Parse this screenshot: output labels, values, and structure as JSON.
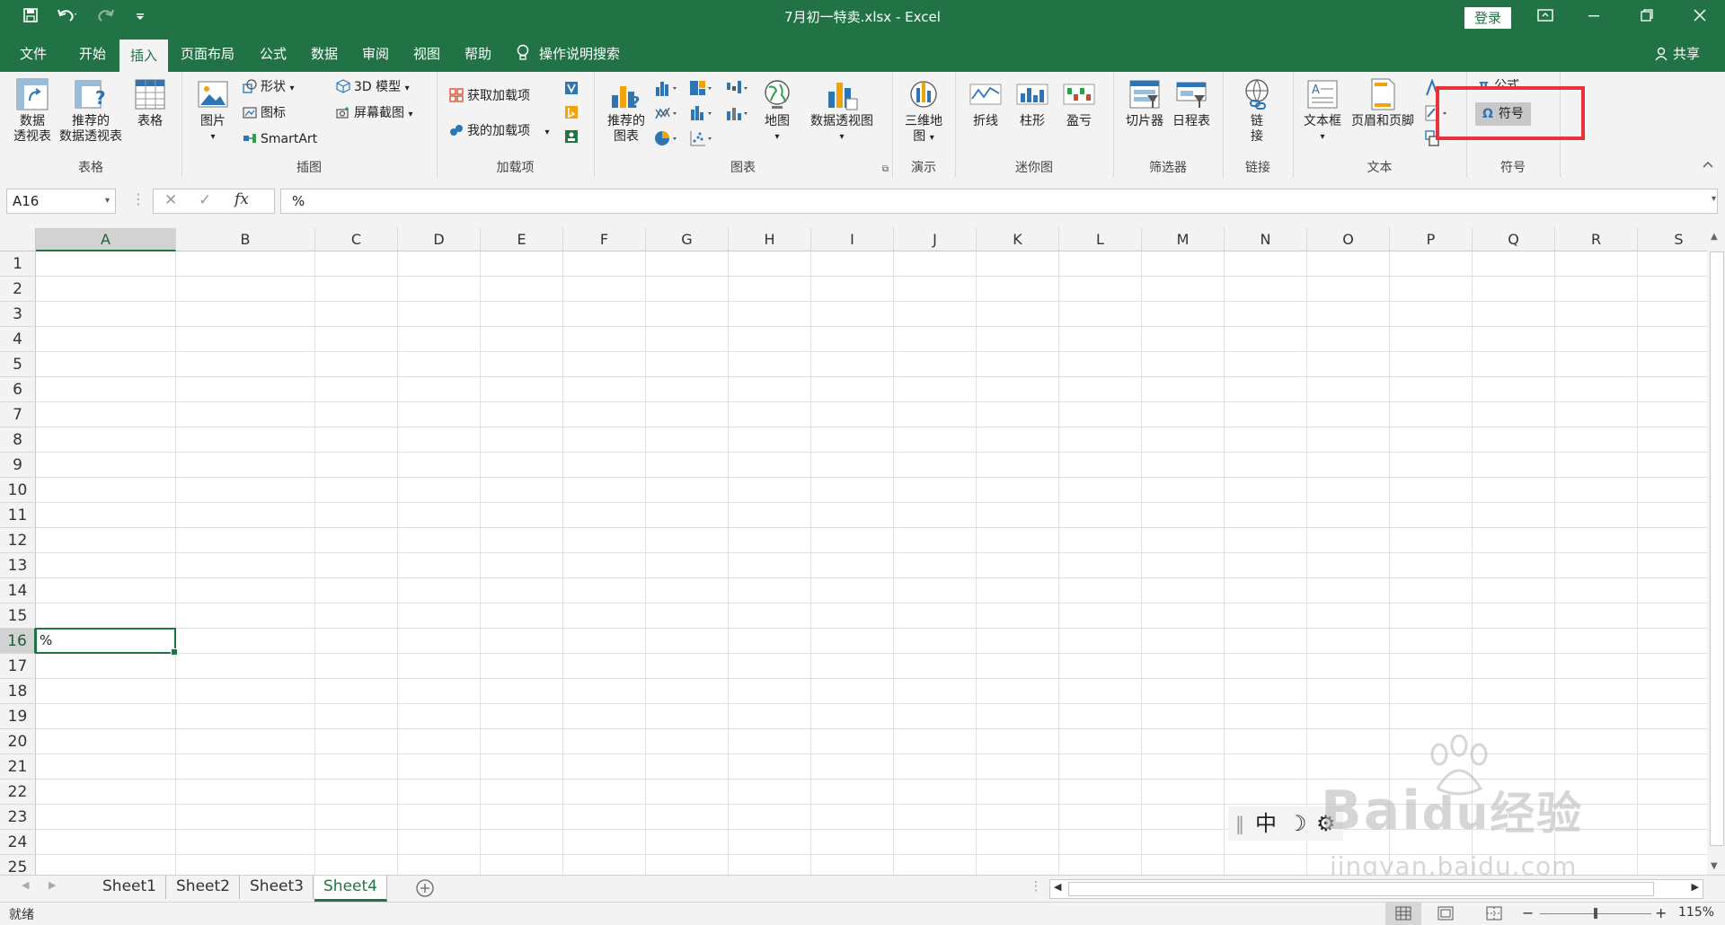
{
  "window": {
    "title": "7月初一特卖.xlsx  -  Excel",
    "login_label": "登录",
    "share_label": "共享"
  },
  "tabs": [
    "文件",
    "开始",
    "插入",
    "页面布局",
    "公式",
    "数据",
    "审阅",
    "视图",
    "帮助"
  ],
  "active_tab": "插入",
  "tell_me": "操作说明搜索",
  "ribbon": {
    "tables": {
      "label": "表格",
      "pivot": [
        "数据",
        "透视表"
      ],
      "recommended_pivot": [
        "推荐的",
        "数据透视表"
      ],
      "table": "表格"
    },
    "illustrations": {
      "label": "插图",
      "pictures": "图片",
      "shapes": "形状",
      "icons": "图标",
      "smartart": "SmartArt",
      "model3d": "3D 模型",
      "screenshot": "屏幕截图"
    },
    "addins": {
      "label": "加载项",
      "get": "获取加载项",
      "mine": "我的加载项"
    },
    "charts": {
      "label": "图表",
      "recommended": [
        "推荐的",
        "图表"
      ],
      "map": "地图",
      "pivot_chart": "数据透视图"
    },
    "tours": {
      "label": "演示",
      "map3d": [
        "三维地",
        "图"
      ]
    },
    "sparklines": {
      "label": "迷你图",
      "line": "折线",
      "column": "柱形",
      "winloss": "盈亏"
    },
    "filters": {
      "label": "筛选器",
      "slicer": "切片器",
      "timeline": "日程表"
    },
    "links": {
      "label": "链接",
      "link": [
        "链",
        "接"
      ]
    },
    "text": {
      "label": "文本",
      "textbox": "文本框",
      "header_footer": "页眉和页脚"
    },
    "symbols": {
      "label": "符号",
      "equation": "公式",
      "symbol": "符号"
    }
  },
  "formula_bar": {
    "name_box": "A16",
    "formula": "%"
  },
  "columns": [
    "A",
    "B",
    "C",
    "D",
    "E",
    "F",
    "G",
    "H",
    "I",
    "J",
    "K",
    "L",
    "M",
    "N",
    "O",
    "P",
    "Q",
    "R",
    "S"
  ],
  "rows": [
    "1",
    "2",
    "3",
    "4",
    "5",
    "6",
    "7",
    "8",
    "9",
    "10",
    "11",
    "12",
    "13",
    "14",
    "15",
    "16",
    "17",
    "18",
    "19",
    "20",
    "21",
    "22",
    "23",
    "24",
    "25"
  ],
  "selected_cell": {
    "col": "A",
    "row": "16",
    "value": "%"
  },
  "sheets": [
    "Sheet1",
    "Sheet2",
    "Sheet3",
    "Sheet4"
  ],
  "active_sheet": "Sheet4",
  "status": {
    "ready": "就绪",
    "zoom": "115%"
  },
  "ime": {
    "mode": "中"
  },
  "watermark": {
    "brand": "Bai",
    "brand2": "du",
    "cn": "经验",
    "url": "jingyan.baidu.com"
  },
  "colors": {
    "excel_green": "#217346",
    "highlight_red": "#e8323a"
  }
}
